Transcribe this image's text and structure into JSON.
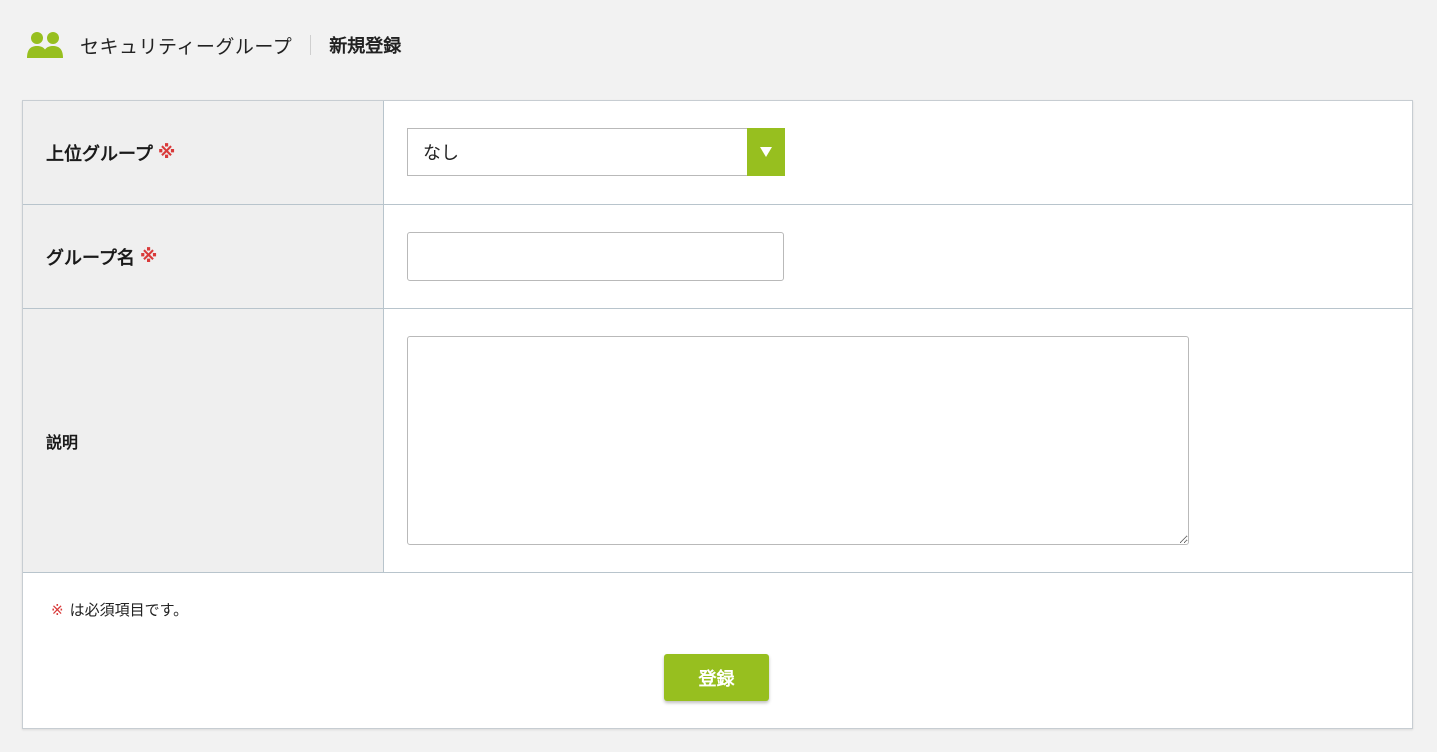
{
  "colors": {
    "accent": "#97bf1f",
    "required_mark": "#d93a3a",
    "label_bg": "#efefef",
    "page_bg": "#f2f2f2"
  },
  "header": {
    "icon": "users-group-icon",
    "section_title": "セキュリティーグループ",
    "page_title": "新規登録"
  },
  "form": {
    "parent_group": {
      "label": "上位グループ",
      "required_mark": "※",
      "selected_value": "なし",
      "arrow_icon": "triangle-down-icon"
    },
    "group_name": {
      "label": "グループ名",
      "required_mark": "※",
      "value": "",
      "placeholder": ""
    },
    "description": {
      "label": "説明",
      "value": ""
    }
  },
  "footer": {
    "required_mark": "※",
    "note": "は必須項目です。",
    "submit_label": "登録"
  }
}
